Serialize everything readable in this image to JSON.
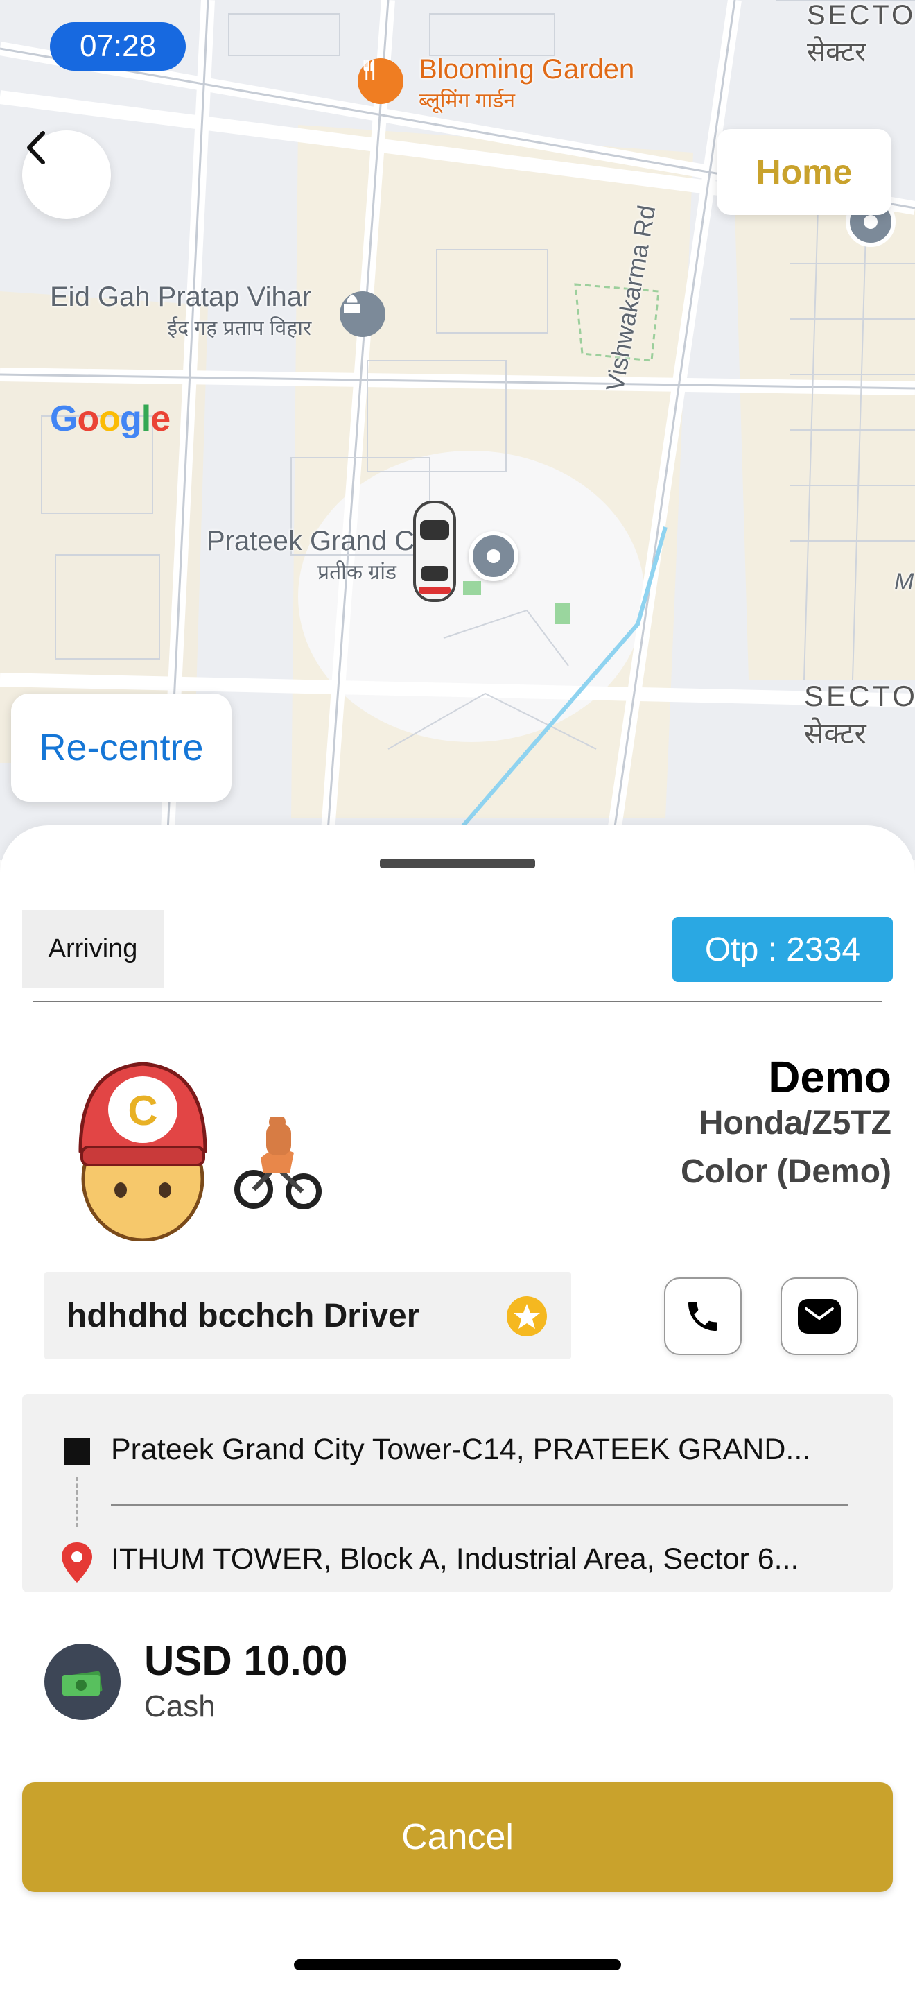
{
  "status_bar": {
    "time": "07:28"
  },
  "map": {
    "places": [
      {
        "name_en": "Blooming Garden",
        "name_hi": "ब्लूमिंग गार्डन",
        "icon": "restaurant-icon"
      },
      {
        "name_en": "Eid Gah Pratap Vihar",
        "name_hi": "ईद गह प्रताप विहार",
        "icon": "landmark-icon"
      },
      {
        "name_en": "Prateek Grand C",
        "name_hi": "प्रतीक ग्रांड",
        "icon": "location-pin-icon"
      }
    ],
    "road_label": "Vishwakarma Rd",
    "sector_labels": [
      {
        "en": "SECTO",
        "hi": "सेक्टर"
      },
      {
        "en": "SECTO",
        "hi": "सेक्टर"
      }
    ],
    "edge_letter": "M",
    "logo": "Google",
    "vehicle_icon": "car-icon"
  },
  "buttons": {
    "back_icon": "back-chevron-icon",
    "home": "Home",
    "recentre": "Re-centre",
    "cancel": "Cancel"
  },
  "trip": {
    "status": "Arriving",
    "otp": "Otp : 2334"
  },
  "driver": {
    "name": "Demo",
    "vehicle": "Honda/Z5TZ",
    "color": "Color (Demo)",
    "label": "hdhdhd bcchch Driver",
    "rating_icon": "star-icon",
    "actions": [
      {
        "name": "call-button",
        "icon": "phone-icon"
      },
      {
        "name": "message-button",
        "icon": "message-icon"
      }
    ]
  },
  "route": {
    "pickup": "Prateek Grand City Tower-C14, PRATEEK GRAND...",
    "dropoff": "ITHUM TOWER, Block A, Industrial Area, Sector 6..."
  },
  "payment": {
    "amount": "USD 10.00",
    "method": "Cash",
    "icon": "cash-icon"
  },
  "colors": {
    "accent_gold": "#c9a22c",
    "otp_blue": "#2aa8e3",
    "link_blue": "#1576d6",
    "time_pill_blue": "#1769e0"
  }
}
